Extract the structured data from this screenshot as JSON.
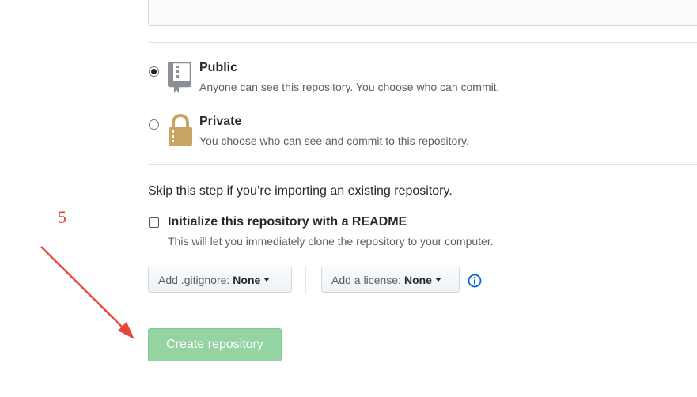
{
  "visibility": {
    "public": {
      "title": "Public",
      "description": "Anyone can see this repository. You choose who can commit.",
      "selected": true
    },
    "private": {
      "title": "Private",
      "description": "You choose who can see and commit to this repository.",
      "selected": false
    }
  },
  "import_note": "Skip this step if you’re importing an existing repository.",
  "readme": {
    "label": "Initialize this repository with a README",
    "description": "This will let you immediately clone the repository to your computer.",
    "checked": false
  },
  "gitignore": {
    "prefix": "Add .gitignore:",
    "value": "None"
  },
  "license": {
    "prefix": "Add a license:",
    "value": "None"
  },
  "create_button": {
    "label": "Create repository",
    "enabled": false
  },
  "annotation": {
    "label": "5",
    "color": "#e8483b"
  },
  "colors": {
    "create_button_bg": "#94d3a2",
    "info_icon": "#0366d6",
    "lock_icon": "#c9a563"
  },
  "icons": [
    "repo-book-icon",
    "lock-icon",
    "info-icon",
    "caret-down-icon"
  ]
}
